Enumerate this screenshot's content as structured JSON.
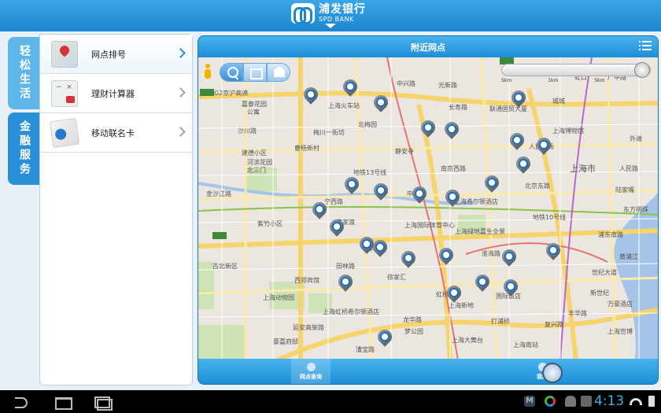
{
  "header": {
    "brand_cn": "浦发银行",
    "brand_en": "SPD BANK"
  },
  "side_tabs": [
    {
      "label": "轻松生活"
    },
    {
      "label": "金融服务"
    }
  ],
  "menu": {
    "items": [
      {
        "label": "网点排号",
        "icon": "map-pin-icon",
        "active": true
      },
      {
        "label": "理财计算器",
        "icon": "calculator-icon",
        "active": false
      },
      {
        "label": "移动联名卡",
        "icon": "card-icon",
        "active": false
      }
    ]
  },
  "panel": {
    "title": "附近网点"
  },
  "map": {
    "zoom_scale": [
      "5km",
      "1km",
      "5km"
    ],
    "labels": {
      "l1": "G2京沪高速",
      "l2": "嘉泰花园",
      "l3": "公寓",
      "l4": "上海火车站",
      "l5": "梅川一街坊",
      "l6": "北梅园",
      "l7": "沙川路",
      "l8": "中兴路",
      "l9": "光新路",
      "l10": "长寿路",
      "l11": "联通国贸大厦",
      "l12": "城城",
      "l13": "上海市",
      "l14": "人民路",
      "l15": "地铁13号线",
      "l16": "建德小区",
      "l17": "河滨花园",
      "l18": "北三门",
      "l19": "中兴路",
      "l20": "上海希尔顿酒店",
      "l21": "紫竹小区",
      "l22": "地铁10号线",
      "l23": "上海国际体育中心",
      "l24": "上海绿地嘉生全景",
      "l25": "西郊宾馆",
      "l26": "虹桥路",
      "l27": "上海动物园",
      "l28": "上海虹桥希尔顿酒店",
      "l29": "延安高架路",
      "l30": "豪嘉府邸",
      "l31": "上海大舞台",
      "l32": "梦公园",
      "l33": "上海世博",
      "l34": "黄浦江",
      "l35": "丰华路",
      "l36": "上海新地",
      "l37": "国际饭店",
      "l38": "新世纪",
      "l39": "上海南站",
      "l40": "宁西路",
      "l41": "曹杨新村",
      "l42": "淮海路",
      "l43": "北京东路",
      "l44": "世纪大道",
      "l45": "华山路",
      "l46": "广中路",
      "l47": "漕宝路",
      "l48": "人民广场",
      "l49": "曹家渡",
      "l50": "浦东南路",
      "l51": "金沙江路",
      "l52": "南京西路",
      "l53": "东方明珠",
      "l54": "打浦桥",
      "l55": "万豪酒店",
      "l56": "陆家嘴",
      "l57": "复兴路",
      "l58": "龙华路",
      "l59": "上海博物馆",
      "l60": "静安寺",
      "l61": "徐家汇",
      "l62": "外滩",
      "l63": "虹口",
      "l64": "田林路",
      "l65": "古北新区"
    }
  },
  "footer": {
    "tab1": "网点查询",
    "tab2": "我的"
  },
  "status": {
    "time": "4:13"
  },
  "colors": {
    "accent": "#1e8fd6",
    "brand_red": "#d6343a"
  }
}
